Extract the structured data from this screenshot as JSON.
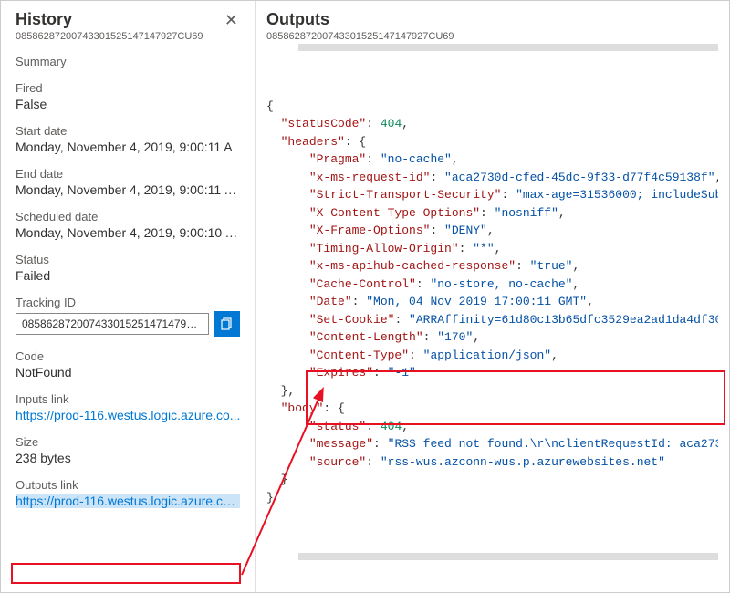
{
  "history": {
    "title": "History",
    "run_id": "08586287200743301525147147927CU69",
    "summary_label": "Summary",
    "fired_label": "Fired",
    "fired_value": "False",
    "start_label": "Start date",
    "start_value": "Monday, November 4, 2019, 9:00:11 A",
    "end_label": "End date",
    "end_value": "Monday, November 4, 2019, 9:00:11 A...",
    "scheduled_label": "Scheduled date",
    "scheduled_value": "Monday, November 4, 2019, 9:00:10 A...",
    "status_label": "Status",
    "status_value": "Failed",
    "tracking_label": "Tracking ID",
    "tracking_value": "085862872007433015251471479…",
    "code_label": "Code",
    "code_value": "NotFound",
    "inputs_link_label": "Inputs link",
    "inputs_link_value": "https://prod-116.westus.logic.azure.co...",
    "size_label": "Size",
    "size_value": "238 bytes",
    "outputs_link_label": "Outputs link",
    "outputs_link_value": "https://prod-116.westus.logic.azure.co..."
  },
  "outputs": {
    "title": "Outputs",
    "run_id": "08586287200743301525147147927CU69",
    "json": {
      "statusCode": 404,
      "headers": {
        "Pragma": "no-cache",
        "x-ms-request-id": "aca2730d-cfed-45dc-9f33-d77f4c59138f",
        "Strict-Transport-Security": "max-age=31536000; includeSub",
        "X-Content-Type-Options": "nosniff",
        "X-Frame-Options": "DENY",
        "Timing-Allow-Origin": "*",
        "x-ms-apihub-cached-response": "true",
        "Cache-Control": "no-store, no-cache",
        "Date": "Mon, 04 Nov 2019 17:00:11 GMT",
        "Set-Cookie": "ARRAffinity=61d80c13b65dfc3529ea2ad1da4df30",
        "Content-Length": "170",
        "Content-Type": "application/json",
        "Expires": "-1"
      },
      "body": {
        "status": 404,
        "message": "RSS feed not found.\\r\\nclientRequestId: aca273",
        "source": "rss-wus.azconn-wus.p.azurewebsites.net"
      }
    }
  }
}
